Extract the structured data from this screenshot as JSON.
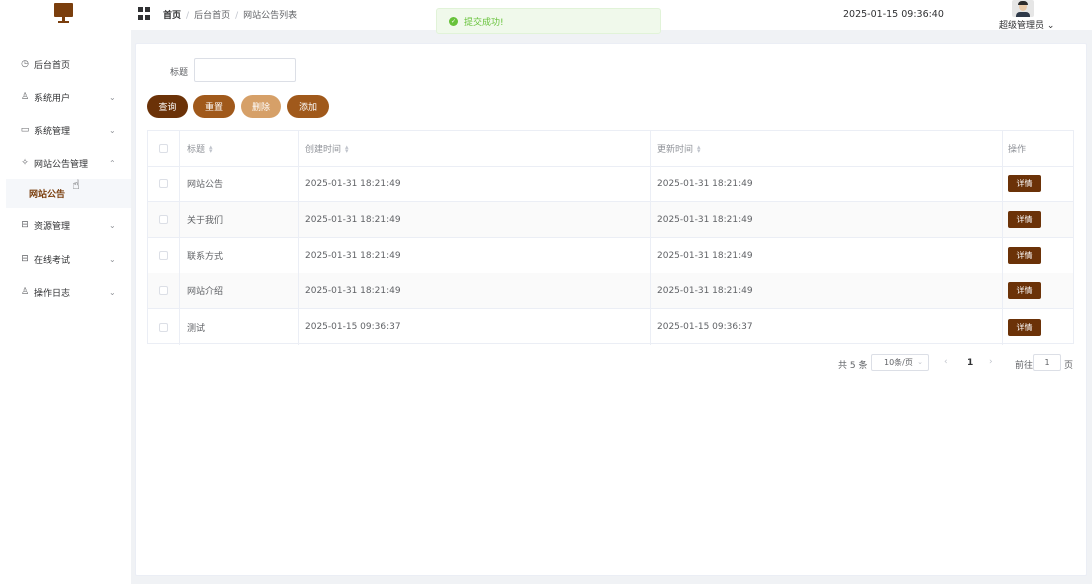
{
  "header": {
    "breadcrumb": [
      "首页",
      "后台首页",
      "网站公告列表"
    ],
    "datetime": "2025-01-15 09:36:40",
    "user_name": "超级管理员"
  },
  "toast": {
    "message": "提交成功!",
    "icon": "check-circle-icon",
    "color": "#67c23a"
  },
  "sidebar": {
    "items": [
      {
        "label": "后台首页",
        "icon": "clock-icon"
      },
      {
        "label": "系统用户",
        "icon": "user-icon"
      },
      {
        "label": "系统管理",
        "icon": "folder-icon"
      },
      {
        "label": "网站公告管理",
        "icon": "magic-icon"
      },
      {
        "label": "资源管理",
        "icon": "tray-icon"
      },
      {
        "label": "在线考试",
        "icon": "tray-icon"
      },
      {
        "label": "操作日志",
        "icon": "user-icon"
      }
    ],
    "active_sub": "网站公告"
  },
  "search": {
    "label": "标题",
    "value": "",
    "placeholder": ""
  },
  "buttons": {
    "query": "查询",
    "reset": "重置",
    "delete": "删除",
    "add": "添加"
  },
  "table": {
    "headers": [
      "标题",
      "创建时间",
      "更新时间",
      "操作"
    ],
    "rows": [
      {
        "title": "网站公告",
        "created": "2025-01-31 18:21:49",
        "updated": "2025-01-31 18:21:49",
        "action": "详情"
      },
      {
        "title": "关于我们",
        "created": "2025-01-31 18:21:49",
        "updated": "2025-01-31 18:21:49",
        "action": "详情"
      },
      {
        "title": "联系方式",
        "created": "2025-01-31 18:21:49",
        "updated": "2025-01-31 18:21:49",
        "action": "详情"
      },
      {
        "title": "网站介绍",
        "created": "2025-01-31 18:21:49",
        "updated": "2025-01-31 18:21:49",
        "action": "详情"
      },
      {
        "title": "测试",
        "created": "2025-01-15 09:36:37",
        "updated": "2025-01-15 09:36:37",
        "action": "详情"
      }
    ]
  },
  "pagination": {
    "total": "共 5 条",
    "page_size": "10条/页",
    "current_page": "1",
    "goto_label": "前往",
    "goto_value": "1",
    "unit": "页"
  },
  "colors": {
    "brand": "#6b3208",
    "accent": "#a0591b",
    "light_accent": "#d6a068"
  }
}
